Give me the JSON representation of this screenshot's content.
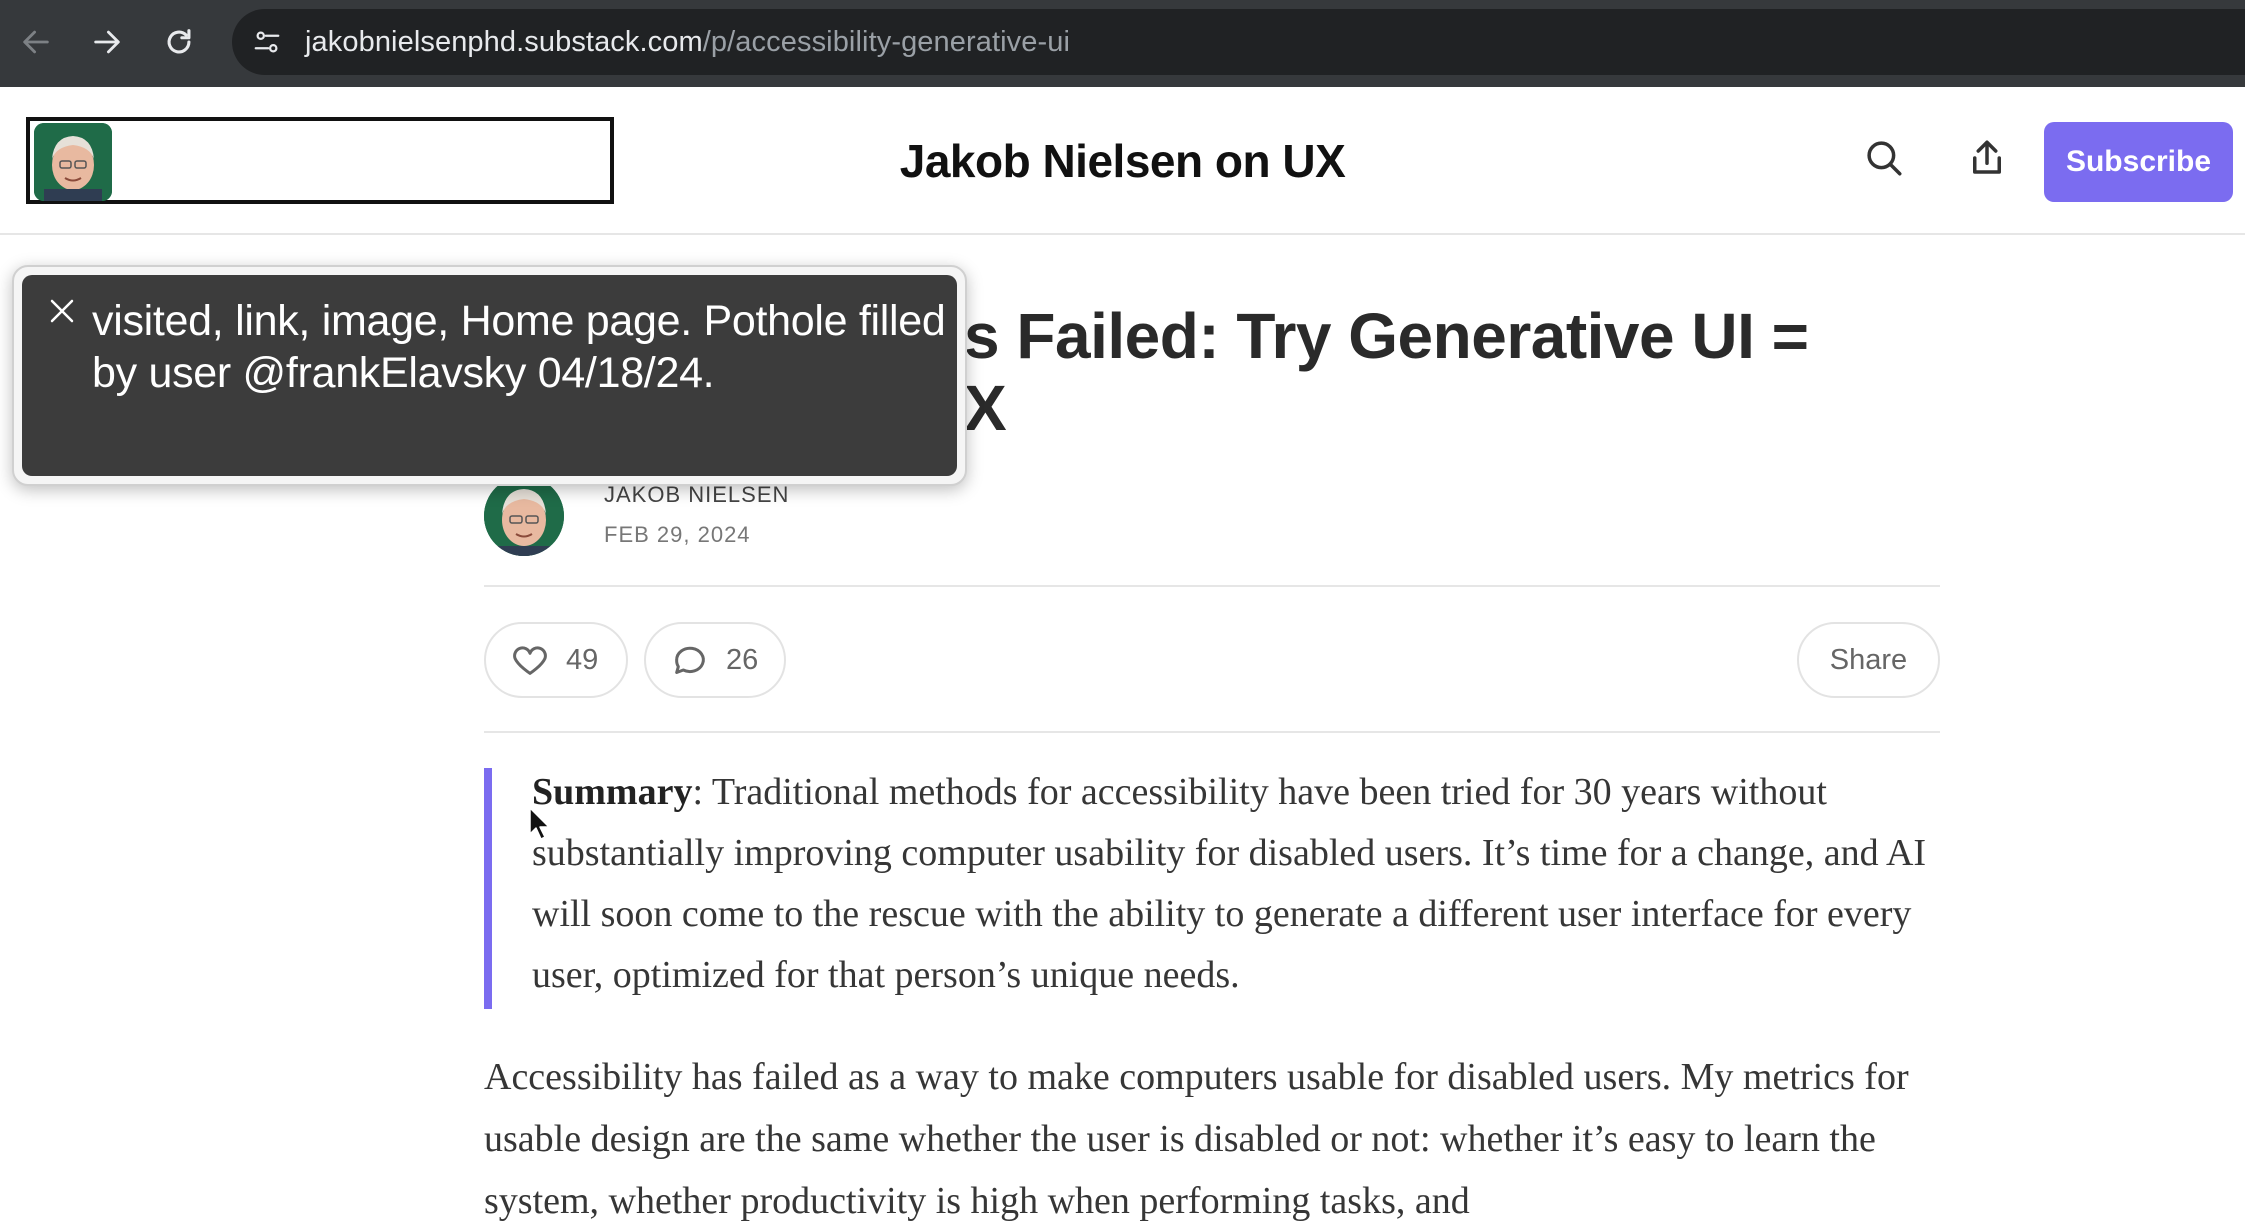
{
  "browser": {
    "url_host": "jakobnielsenphd.substack.com",
    "url_path": "/p/accessibility-generative-ui",
    "icons": [
      "back-arrow-icon",
      "forward-arrow-icon",
      "reload-icon",
      "site-settings-icon"
    ]
  },
  "header": {
    "publication_title": "Jakob Nielsen on UX",
    "subscribe_label": "Subscribe",
    "icons": [
      "search-icon",
      "share-upload-icon"
    ]
  },
  "article": {
    "title_line1": "s Failed: Try Generative UI =",
    "title_line2": "X",
    "author": "JAKOB NIELSEN",
    "date": "FEB 29, 2024",
    "likes": "49",
    "comments": "26",
    "share_label": "Share",
    "summary_label": "Summary",
    "summary_text": ": Traditional methods for accessibility have been tried for 30 years without substantially improving computer usability for disabled users. It’s time for a change, and AI will soon come to the rescue with the ability to generate a different user interface for every user, optimized for that person’s unique needs.",
    "body_text": "Accessibility has failed as a way to make computers usable for disabled users. My metrics for usable design are the same whether the user is disabled or not: whether it’s easy to learn the system, whether productivity is high when performing tasks, and"
  },
  "tooltip": {
    "text": "visited, link, image, Home page. Pothole filled by user @frankElavsky 04/18/24."
  },
  "colors": {
    "accent": "#7b6cf0",
    "chrome_bg": "#36393c",
    "url_bar_bg": "#202224",
    "tooltip_bg": "#3c3c3c"
  }
}
